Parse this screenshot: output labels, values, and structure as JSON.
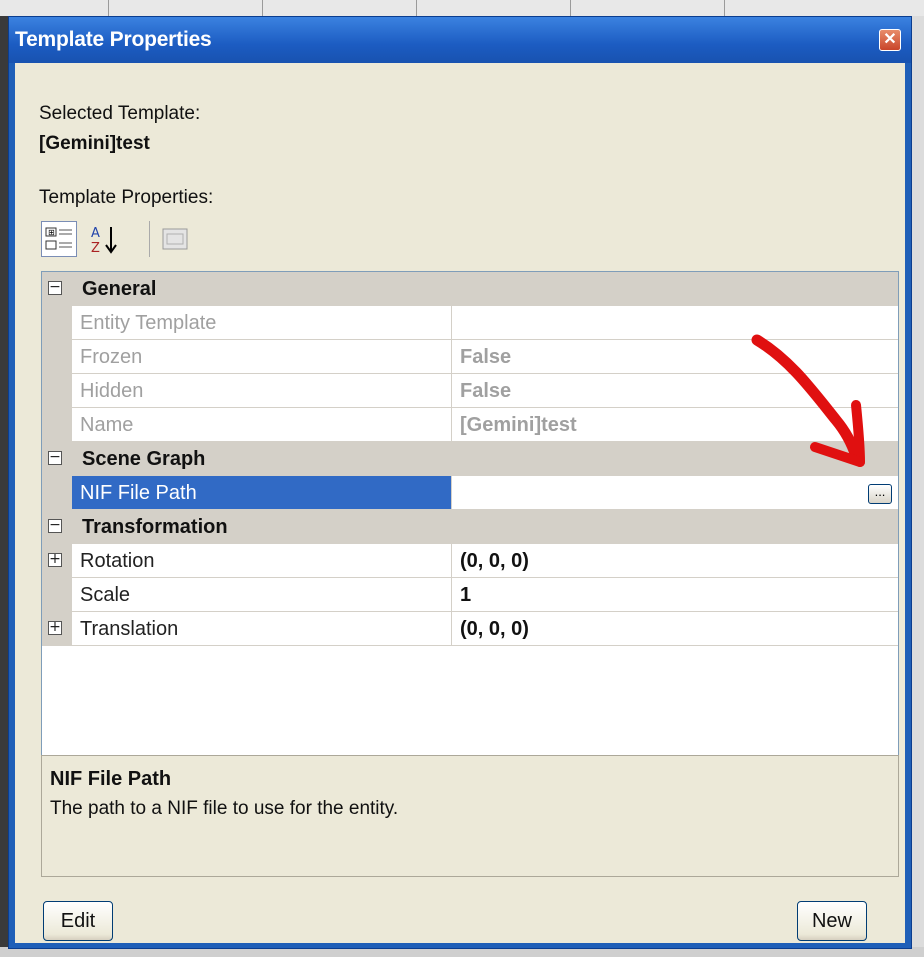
{
  "window": {
    "title": "Template Properties"
  },
  "selected_template": {
    "label": "Selected Template:",
    "value": "[Gemini]test"
  },
  "properties_label": "Template Properties:",
  "toolbar": {
    "categorized_icon": "categorized-view-icon",
    "alphabetical_icon": "alphabetical-sort-icon",
    "property_pages_icon": "property-pages-icon"
  },
  "property_grid": {
    "categories": [
      {
        "name": "General",
        "items": [
          {
            "name": "Entity Template",
            "value": "",
            "disabled": true
          },
          {
            "name": "Frozen",
            "value": "False",
            "disabled": true
          },
          {
            "name": "Hidden",
            "value": "False",
            "disabled": true
          },
          {
            "name": "Name",
            "value": "[Gemini]test",
            "disabled": true
          }
        ]
      },
      {
        "name": "Scene Graph",
        "items": [
          {
            "name": "NIF File Path",
            "value": "",
            "selected": true,
            "button": "..."
          }
        ]
      },
      {
        "name": "Transformation",
        "items": [
          {
            "name": "Rotation",
            "value": "(0, 0, 0)",
            "expandable": true
          },
          {
            "name": "Scale",
            "value": "1"
          },
          {
            "name": "Translation",
            "value": "(0, 0, 0)",
            "expandable": true
          }
        ]
      }
    ]
  },
  "description": {
    "title": "NIF File Path",
    "text": "The path to a NIF file to use for the entity."
  },
  "buttons": {
    "edit": "Edit",
    "new": "New"
  },
  "colors": {
    "selection": "#316ac5",
    "annotation_arrow": "#e01010",
    "titlebar": "#1c5cc2"
  }
}
